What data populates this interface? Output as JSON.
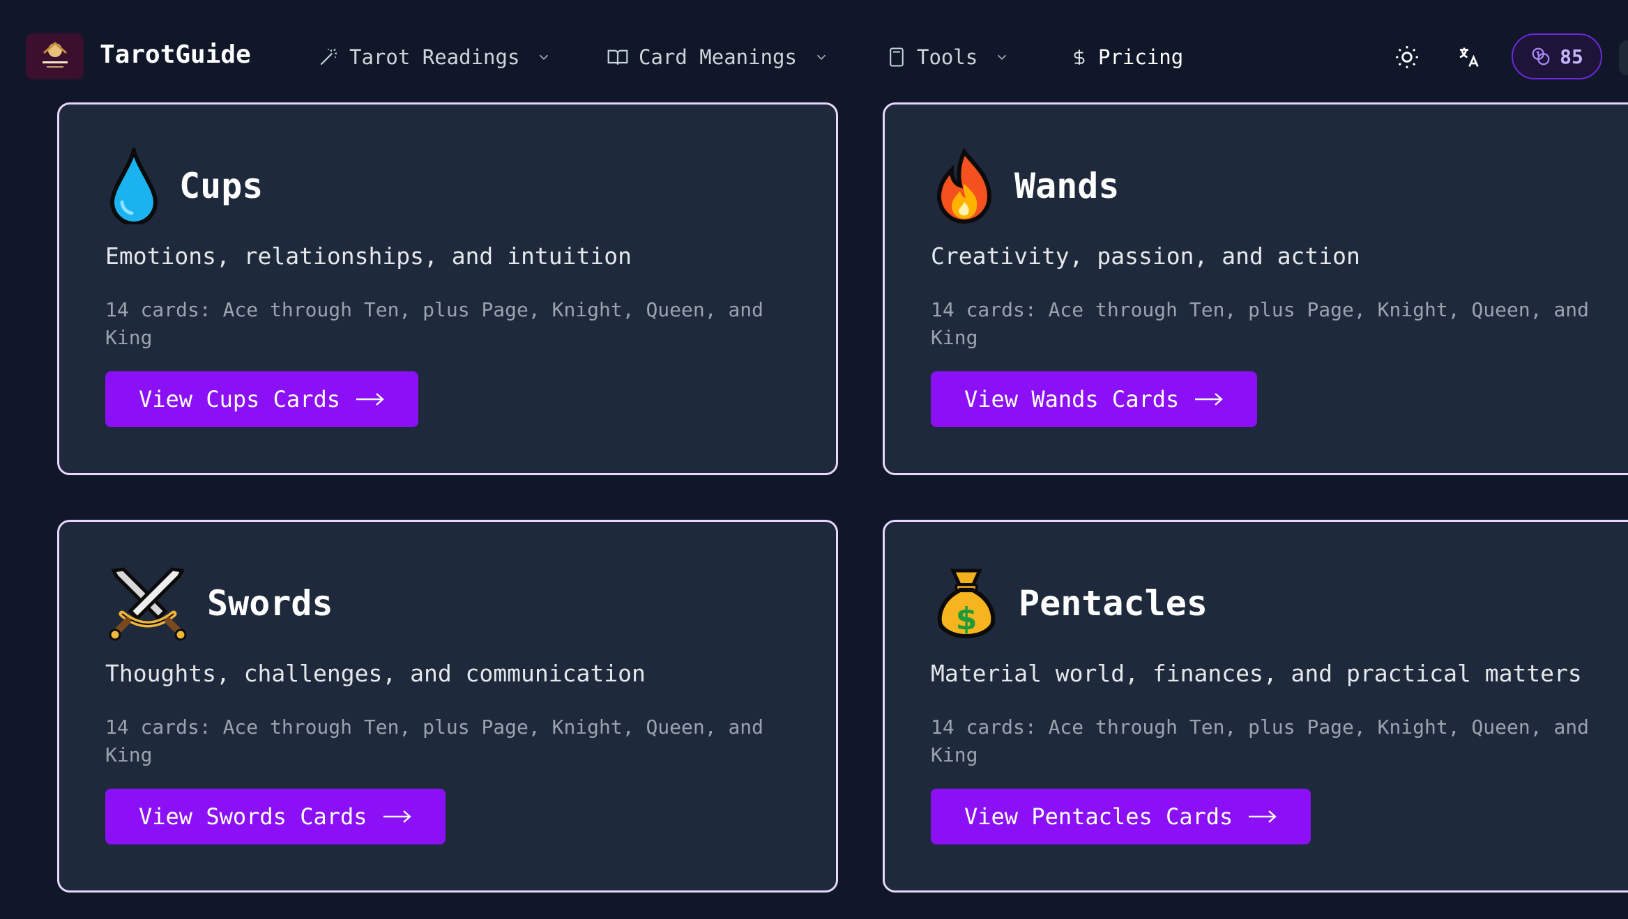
{
  "nav": {
    "brand": "TarotGuide",
    "items": [
      {
        "label": "Tarot Readings",
        "icon": "wand-icon"
      },
      {
        "label": "Card Meanings",
        "icon": "book-open-icon"
      },
      {
        "label": "Tools",
        "icon": "calculator-icon"
      },
      {
        "label": "Pricing",
        "icon": "dollar-icon"
      }
    ],
    "credits": "85"
  },
  "suits": [
    {
      "title": "Cups",
      "icon": "water-drop-icon",
      "subtitle": "Emotions, relationships, and intuition",
      "description": "14 cards: Ace through Ten, plus Page, Knight, Queen, and King",
      "button": "View Cups Cards"
    },
    {
      "title": "Wands",
      "icon": "fire-icon",
      "subtitle": "Creativity, passion, and action",
      "description": "14 cards: Ace through Ten, plus Page, Knight, Queen, and King",
      "button": "View Wands Cards"
    },
    {
      "title": "Swords",
      "icon": "crossed-swords-icon",
      "subtitle": "Thoughts, challenges, and communication",
      "description": "14 cards: Ace through Ten, plus Page, Knight, Queen, and King",
      "button": "View Swords Cards"
    },
    {
      "title": "Pentacles",
      "icon": "money-bag-icon",
      "subtitle": "Material world, finances, and practical matters",
      "description": "14 cards: Ace through Ten, plus Page, Knight, Queen, and King",
      "button": "View Pentacles Cards"
    }
  ],
  "colors": {
    "background": "#0f1729",
    "card": "#1e293b",
    "card_border": "#e9d5ff",
    "button": "#8b10f5"
  }
}
